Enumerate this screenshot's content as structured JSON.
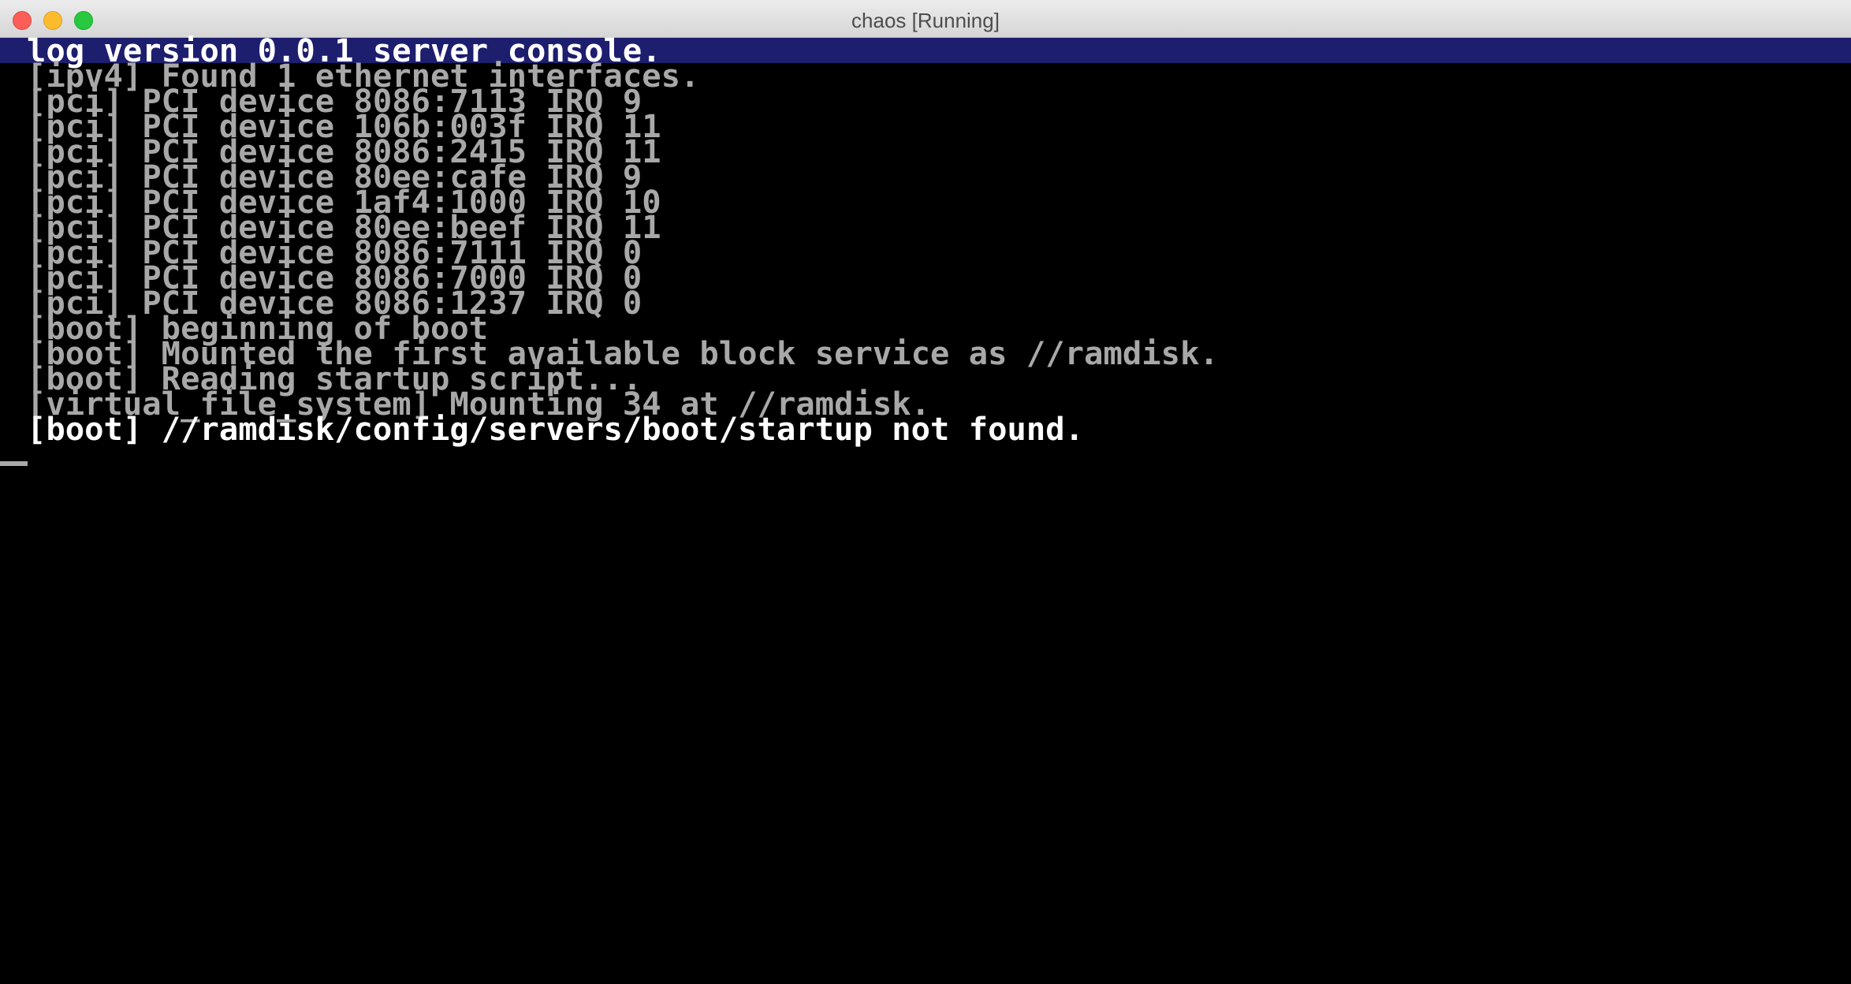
{
  "window": {
    "title": "chaos [Running]"
  },
  "console": {
    "header": "log version 0.0.1 server console.",
    "lines": [
      "[ipv4] Found 1 ethernet interfaces.",
      "[pci] PCI device 8086:7113 IRQ 9",
      "[pci] PCI device 106b:003f IRQ 11",
      "[pci] PCI device 8086:2415 IRQ 11",
      "[pci] PCI device 80ee:cafe IRQ 9",
      "[pci] PCI device 1af4:1000 IRQ 10",
      "[pci] PCI device 80ee:beef IRQ 11",
      "[pci] PCI device 8086:7111 IRQ 0",
      "[pci] PCI device 8086:7000 IRQ 0",
      "[pci] PCI device 8086:1237 IRQ 0",
      "[boot] beginning of boot",
      "[boot] Mounted the first available block service as //ramdisk.",
      "[boot] Reading startup script...",
      "[virtual_file_system] Mounting 34 at //ramdisk."
    ],
    "last_line": "[boot] //ramdisk/config/servers/boot/startup not found."
  },
  "colors": {
    "header_bar": "#1e1e6e",
    "text_dim": "#a8a8a8",
    "text_bright": "#ffffff",
    "background": "#000000"
  }
}
